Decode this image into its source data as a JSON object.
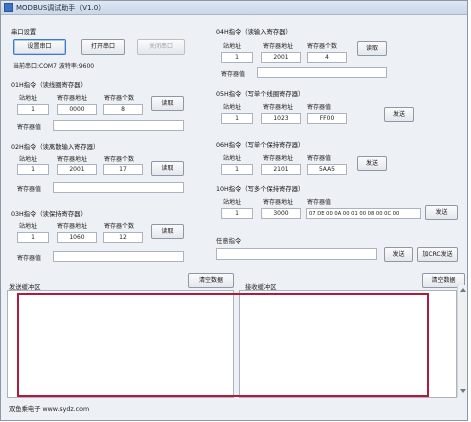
{
  "window": {
    "title": "MODBUS调试助手（V1.0）"
  },
  "serial": {
    "group_label": "串口设置",
    "set_button": "设置串口",
    "open_button": "打开串口",
    "close_button": "关闭串口",
    "status": "当前串口:COM7 波特率:9600"
  },
  "cmd01": {
    "title": "01H指令（读线圈寄存器）",
    "addr_label": "站地址",
    "reg_addr_label": "寄存器地址",
    "count_label": "寄存器个数",
    "addr": "1",
    "reg_addr": "0000",
    "count": "8",
    "read_button": "读取",
    "value_label": "寄存器值",
    "value": ""
  },
  "cmd02": {
    "title": "02H指令（读离散输入寄存器）",
    "addr_label": "站地址",
    "reg_addr_label": "寄存器地址",
    "count_label": "寄存器个数",
    "addr": "1",
    "reg_addr": "2001",
    "count": "17",
    "read_button": "读取",
    "value_label": "寄存器值",
    "value": ""
  },
  "cmd03": {
    "title": "03H指令（读保持寄存器）",
    "addr_label": "站地址",
    "reg_addr_label": "寄存器地址",
    "count_label": "寄存器个数",
    "addr": "1",
    "reg_addr": "1060",
    "count": "12",
    "read_button": "读取",
    "value_label": "寄存器值",
    "value": ""
  },
  "cmd04": {
    "title": "04H指令（读输入寄存器）",
    "addr_label": "站地址",
    "reg_addr_label": "寄存器地址",
    "count_label": "寄存器个数",
    "addr": "1",
    "reg_addr": "2001",
    "count": "4",
    "read_button": "读取",
    "value_label": "寄存器值",
    "value": ""
  },
  "cmd05": {
    "title": "05H指令（写单个线圈寄存器）",
    "addr_label": "站地址",
    "reg_addr_label": "寄存器地址",
    "value_label": "寄存器值",
    "addr": "1",
    "reg_addr": "1023",
    "value": "FF00",
    "send_button": "发送"
  },
  "cmd06": {
    "title": "06H指令（写单个保持寄存器）",
    "addr_label": "站地址",
    "reg_addr_label": "寄存器地址",
    "value_label": "寄存器值",
    "addr": "1",
    "reg_addr": "2101",
    "value": "5AA5",
    "send_button": "发送"
  },
  "cmd10": {
    "title": "10H指令（写多个保持寄存器）",
    "addr_label": "站地址",
    "reg_addr_label": "寄存器地址",
    "value_label": "寄存器值",
    "addr": "1",
    "reg_addr": "3000",
    "value": "07 DE 00 0A 00 01 00 08 00 0C 00",
    "send_button": "发送"
  },
  "custom": {
    "label": "任意指令",
    "value": "",
    "send_button": "发送",
    "crc_send_button": "加CRC发送"
  },
  "send_area": {
    "label": "发送缓冲区",
    "clear_button": "清空数据"
  },
  "recv_area": {
    "label": "接收缓冲区",
    "clear_button": "清空数据"
  },
  "footer": {
    "text": "双鱼乘电子 www.sydz.com"
  }
}
